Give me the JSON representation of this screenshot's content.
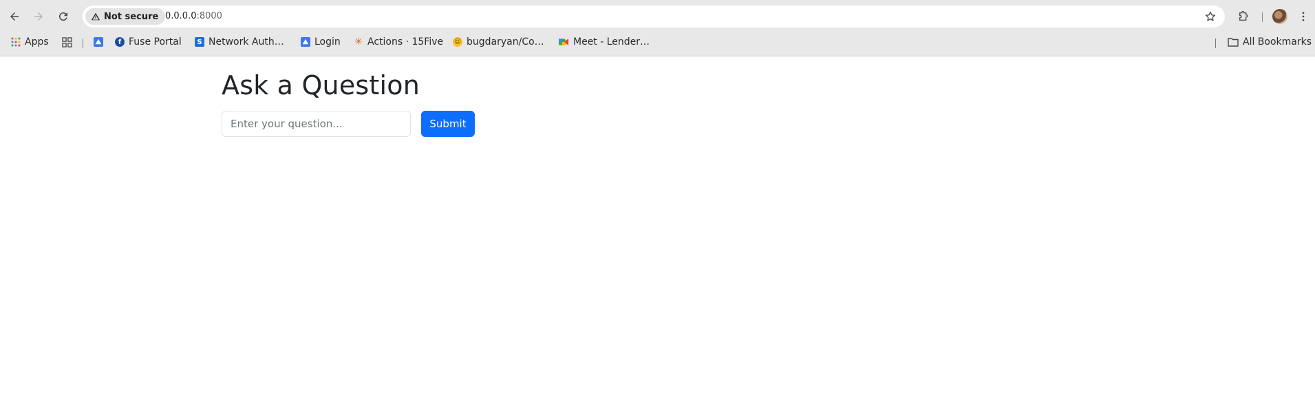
{
  "browser": {
    "security_label": "Not secure",
    "url_host": "0.0.0.0",
    "url_port": ":8000",
    "bookmarks": [
      {
        "label": "Apps",
        "icon": "apps-grid-icon"
      },
      {
        "label": "",
        "icon": "tab-groups-icon"
      },
      {
        "label": "",
        "icon": "image-bookmark-icon"
      },
      {
        "label": "Fuse Portal",
        "icon": "fuse-portal-icon"
      },
      {
        "label": "Network Auth…",
        "icon": "network-auth-icon"
      },
      {
        "label": "Login",
        "icon": "login-icon"
      },
      {
        "label": "Actions · 15Five",
        "icon": "15five-icon"
      },
      {
        "label": "bugdaryan/Co…",
        "icon": "huggingface-icon"
      },
      {
        "label": "Meet - Lender…",
        "icon": "google-meet-icon"
      }
    ],
    "all_bookmarks_label": "All Bookmarks",
    "colors": {
      "chrome_bg": "#e8e8e8",
      "omnibox_bg": "#ffffff"
    }
  },
  "page": {
    "title": "Ask a Question",
    "question_input": {
      "value": "",
      "placeholder": "Enter your question..."
    },
    "submit_label": "Submit",
    "colors": {
      "primary": "#0d6efd",
      "text": "#212529"
    }
  }
}
